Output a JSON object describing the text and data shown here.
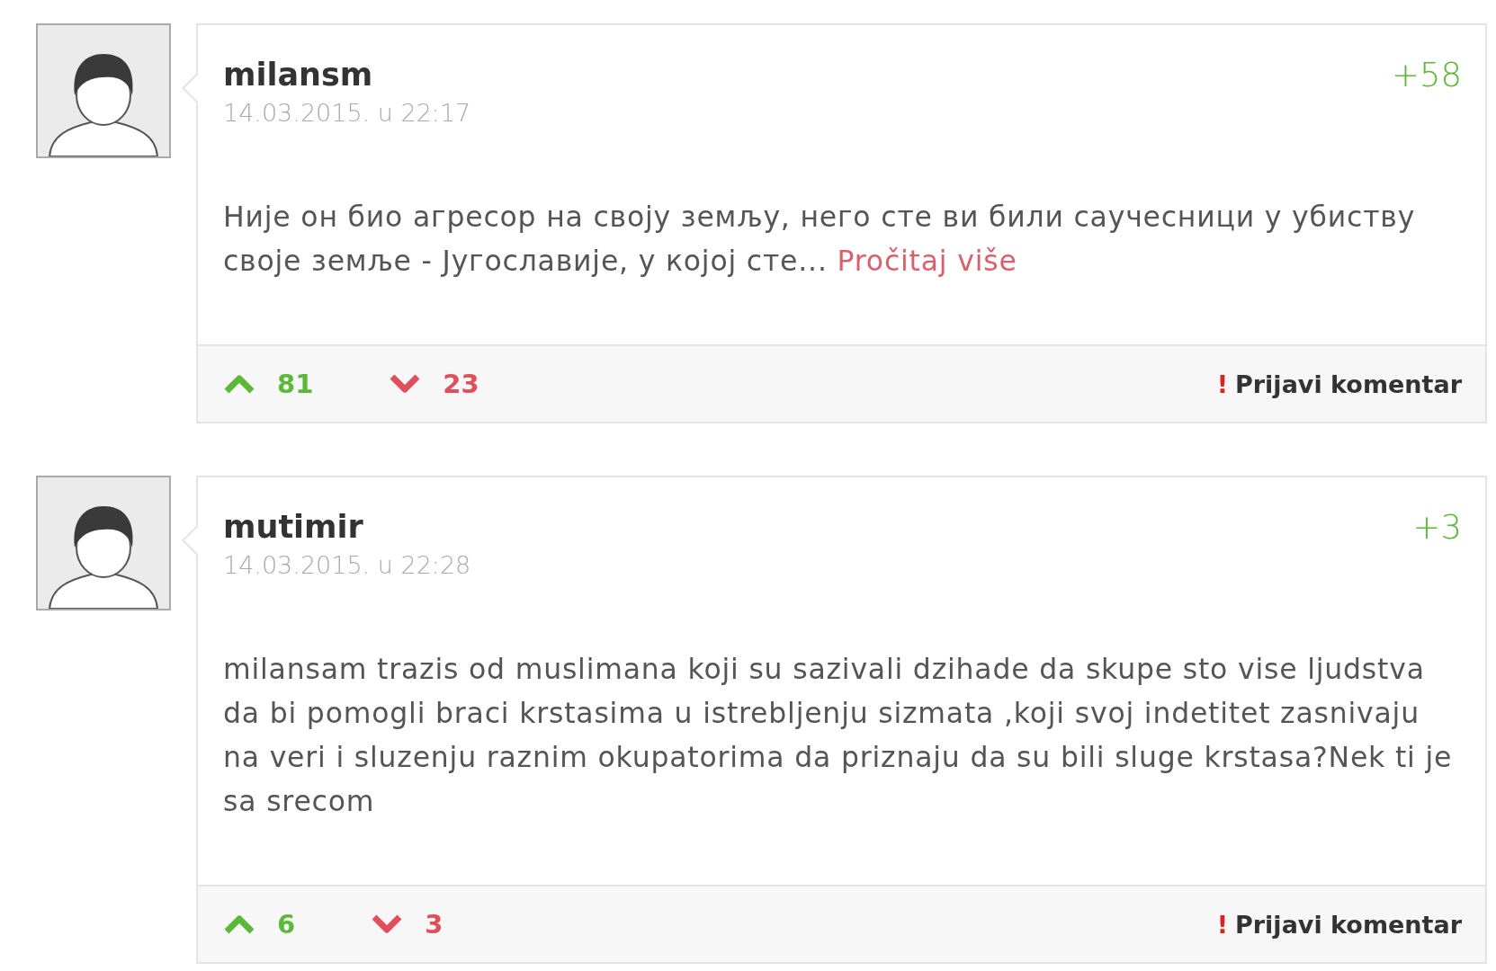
{
  "comments": [
    {
      "username": "milansm",
      "date": "14.03.2015. u 22:17",
      "score": "+58",
      "text": "Није он био агресор на своју земљу, него сте ви били саучесници у убиству своје земље - Југославије, у којој сте...",
      "read_more": "Pročitaj više",
      "upvotes": "81",
      "downvotes": "23",
      "report_mark": "!",
      "report_label": "Prijavi komentar"
    },
    {
      "username": "mutimir",
      "date": "14.03.2015. u 22:28",
      "score": "+3",
      "text": "milansam trazis od muslimana koji su sazivali dzihade da skupe sto vise ljudstva da bi pomogli braci krstasima u istrebljenju sizmata ,koji svoj indetitet zasnivaju na veri i sluzenju raznim okupatorima da priznaju da su bili sluge krstasa?Nek ti je sa srecom",
      "upvotes": "6",
      "downvotes": "3",
      "report_mark": "!",
      "report_label": "Prijavi komentar"
    }
  ]
}
